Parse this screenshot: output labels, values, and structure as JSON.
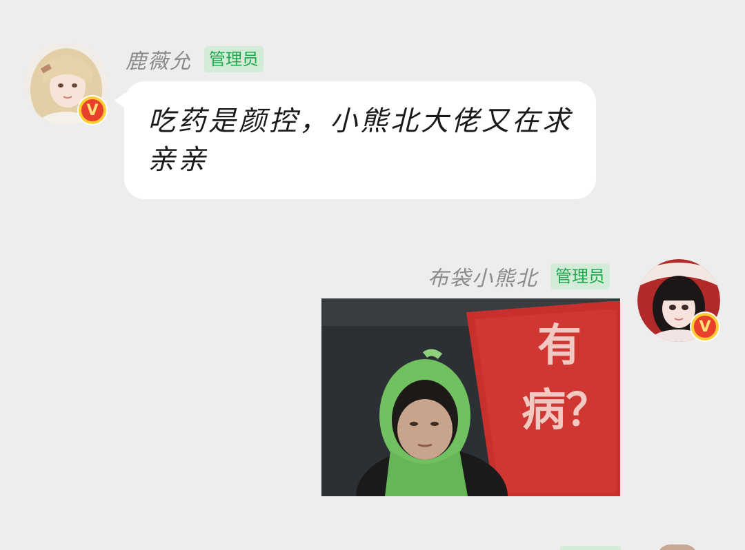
{
  "messages": [
    {
      "sender": "鹿薇允",
      "role": "管理员",
      "type": "text",
      "text": "吃药是颜控，小熊北大佬又在求亲亲",
      "avatar_icon": "girl-blonde-avatar",
      "badge": "V"
    },
    {
      "sender": "布袋小熊北",
      "role": "管理员",
      "type": "image",
      "image_sign_text": "有病？",
      "image_subject": "person-with-green-scarf-holding-red-sign",
      "avatar_icon": "girl-lolita-avatar",
      "badge": "V"
    }
  ],
  "colors": {
    "background": "#ededed",
    "bubble": "#ffffff",
    "role_badge_bg": "#d3ecd8",
    "role_badge_text": "#1ea94f",
    "sender_name": "#8a8a8a",
    "verified_badge": "#e8402a"
  }
}
